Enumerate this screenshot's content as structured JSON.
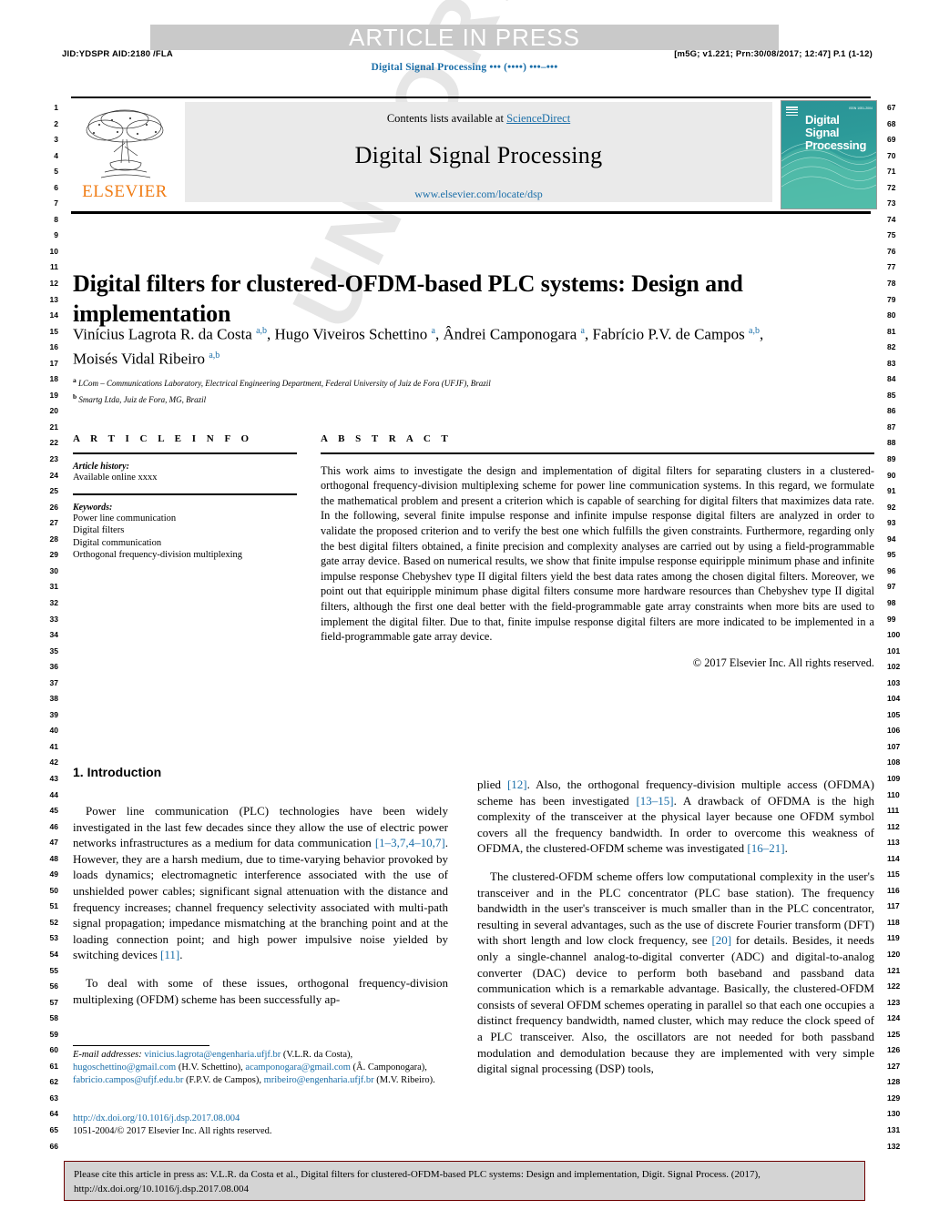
{
  "header": {
    "banner": "ARTICLE IN PRESS",
    "jid_left": "JID:YDSPR   AID:2180 /FLA",
    "jid_right": "[m5G; v1.221; Prn:30/08/2017; 12:47] P.1 (1-12)",
    "running_title": "Digital Signal Processing ••• (••••) •••–•••"
  },
  "masthead": {
    "publisher": "ELSEVIER",
    "contents_prefix": "Contents lists available at ",
    "contents_link": "ScienceDirect",
    "journal_name": "Digital Signal Processing",
    "journal_url": "www.elsevier.com/locate/dsp",
    "cover_title_lines": [
      "Digital",
      "Signal",
      "Processing"
    ],
    "cover_code": "ISSN 1051-2004"
  },
  "article": {
    "title": "Digital filters for clustered-OFDM-based PLC systems: Design and implementation",
    "authors_html": "Vinícius Lagrota R. da Costa <sup>a,b</sup>, Hugo Viveiros Schettino <sup>a</sup>, Ândrei Camponogara <sup>a</sup>, Fabrício P.V. de Campos <sup>a,b</sup>, Moisés Vidal Ribeiro <sup>a,b</sup>",
    "affiliations": [
      {
        "marker": "a",
        "text": "LCom – Communications Laboratory, Electrical Engineering Department, Federal University of Juiz de Fora (UFJF), Brazil"
      },
      {
        "marker": "b",
        "text": "Smartg Ltda, Juiz de Fora, MG, Brazil"
      }
    ]
  },
  "article_info": {
    "heading": "A R T I C L E   I N F O",
    "history_label": "Article history:",
    "history_value": "Available online xxxx",
    "keywords_label": "Keywords:",
    "keywords": [
      "Power line communication",
      "Digital filters",
      "Digital communication",
      "Orthogonal frequency-division multiplexing"
    ]
  },
  "abstract": {
    "heading": "A B S T R A C T",
    "body": "This work aims to investigate the design and implementation of digital filters for separating clusters in a clustered-orthogonal frequency-division multiplexing scheme for power line communication systems. In this regard, we formulate the mathematical problem and present a criterion which is capable of searching for digital filters that maximizes data rate. In the following, several finite impulse response and infinite impulse response digital filters are analyzed in order to validate the proposed criterion and to verify the best one which fulfills the given constraints. Furthermore, regarding only the best digital filters obtained, a finite precision and complexity analyses are carried out by using a field-programmable gate array device. Based on numerical results, we show that finite impulse response equiripple minimum phase and infinite impulse response Chebyshev type II digital filters yield the best data rates among the chosen digital filters. Moreover, we point out that equiripple minimum phase digital filters consume more hardware resources than Chebyshev type II digital filters, although the first one deal better with the field-programmable gate array constraints when more bits are used to implement the digital filter. Due to that, finite impulse response digital filters are more indicated to be implemented in a field-programmable gate array device.",
    "copyright": "© 2017 Elsevier Inc. All rights reserved."
  },
  "body": {
    "section_heading": "1. Introduction",
    "left_paragraphs": [
      "Power line communication (PLC) technologies have been widely investigated in the last few decades since they allow the use of electric power networks infrastructures as a medium for data communication [1–3,7,4–10,7]. However, they are a harsh medium, due to time-varying behavior provoked by loads dynamics; electromagnetic interference associated with the use of unshielded power cables; significant signal attenuation with the distance and frequency increases; channel frequency selectivity associated with multi-path signal propagation; impedance mismatching at the branching point and at the loading connection point; and high power impulsive noise yielded by switching devices [11].",
      "To deal with some of these issues, orthogonal frequency-division multiplexing (OFDM) scheme has been successfully ap-"
    ],
    "right_paragraphs": [
      "plied [12]. Also, the orthogonal frequency-division multiple access (OFDMA) scheme has been investigated [13–15]. A drawback of OFDMA is the high complexity of the transceiver at the physical layer because one OFDM symbol covers all the frequency bandwidth. In order to overcome this weakness of OFDMA, the clustered-OFDM scheme was investigated [16–21].",
      "The clustered-OFDM scheme offers low computational complexity in the user's transceiver and in the PLC concentrator (PLC base station). The frequency bandwidth in the user's transceiver is much smaller than in the PLC concentrator, resulting in several advantages, such as the use of discrete Fourier transform (DFT) with short length and low clock frequency, see [20] for details. Besides, it needs only a single-channel analog-to-digital converter (ADC) and digital-to-analog converter (DAC) device to perform both baseband and passband data communication which is a remarkable advantage. Basically, the clustered-OFDM consists of several OFDM schemes operating in parallel so that each one occupies a distinct frequency bandwidth, named cluster, which may reduce the clock speed of a PLC transceiver. Also, the oscillators are not needed for both passband modulation and demodulation because they are implemented with very simple digital signal processing (DSP) tools,"
    ]
  },
  "footnote": {
    "label": "E-mail addresses:",
    "entries_html": "<span class=\"mail\">vinicius.lagrota@engenharia.ufjf.br</span> (V.L.R. da Costa), <span class=\"mail\">hugoschettino@gmail.com</span> (H.V. Schettino), <span class=\"mail\">acamponogara@gmail.com</span> (Â. Camponogara), <span class=\"mail\">fabricio.campos@ufjf.edu.br</span> (F.P.V. de Campos), <span class=\"mail\">mribeiro@engenharia.ufjf.br</span> (M.V. Ribeiro).",
    "doi": "http://dx.doi.org/10.1016/j.dsp.2017.08.004",
    "issn_line": "1051-2004/© 2017 Elsevier Inc. All rights reserved."
  },
  "cite_box": {
    "text": "Please cite this article in press as: V.L.R. da Costa et al., Digital filters for clustered-OFDM-based PLC systems: Design and implementation, Digit. Signal Process. (2017), http://dx.doi.org/10.1016/j.dsp.2017.08.004"
  },
  "line_numbers": {
    "left_start": 1,
    "left_end": 66,
    "right_start": 67,
    "right_end": 132
  },
  "watermark": "UNCORRECTED PROOF",
  "colors": {
    "link": "#1a6ea8",
    "elsevier_orange": "#F07D16",
    "cover_teal": "#2a9396",
    "banner_gray": "#c9c9c9"
  }
}
